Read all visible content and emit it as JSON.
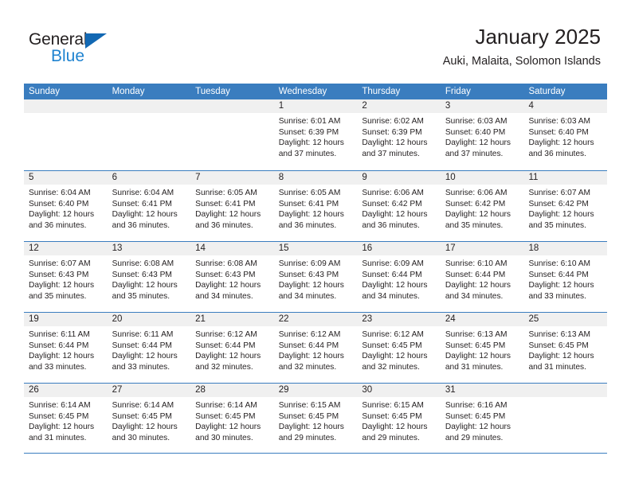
{
  "brand": {
    "name_part1": "General",
    "name_part2": "Blue",
    "accent_color": "#1f83d0",
    "triangle_color": "#1268b3"
  },
  "header": {
    "title": "January 2025",
    "subtitle": "Auki, Malaita, Solomon Islands"
  },
  "calendar": {
    "header_bg": "#3a7dbf",
    "daynum_bg": "#f0f0f0",
    "weekdays": [
      "Sunday",
      "Monday",
      "Tuesday",
      "Wednesday",
      "Thursday",
      "Friday",
      "Saturday"
    ],
    "weeks": [
      [
        {
          "day": "",
          "lines": []
        },
        {
          "day": "",
          "lines": []
        },
        {
          "day": "",
          "lines": []
        },
        {
          "day": "1",
          "lines": [
            "Sunrise: 6:01 AM",
            "Sunset: 6:39 PM",
            "Daylight: 12 hours",
            "and 37 minutes."
          ]
        },
        {
          "day": "2",
          "lines": [
            "Sunrise: 6:02 AM",
            "Sunset: 6:39 PM",
            "Daylight: 12 hours",
            "and 37 minutes."
          ]
        },
        {
          "day": "3",
          "lines": [
            "Sunrise: 6:03 AM",
            "Sunset: 6:40 PM",
            "Daylight: 12 hours",
            "and 37 minutes."
          ]
        },
        {
          "day": "4",
          "lines": [
            "Sunrise: 6:03 AM",
            "Sunset: 6:40 PM",
            "Daylight: 12 hours",
            "and 36 minutes."
          ]
        }
      ],
      [
        {
          "day": "5",
          "lines": [
            "Sunrise: 6:04 AM",
            "Sunset: 6:40 PM",
            "Daylight: 12 hours",
            "and 36 minutes."
          ]
        },
        {
          "day": "6",
          "lines": [
            "Sunrise: 6:04 AM",
            "Sunset: 6:41 PM",
            "Daylight: 12 hours",
            "and 36 minutes."
          ]
        },
        {
          "day": "7",
          "lines": [
            "Sunrise: 6:05 AM",
            "Sunset: 6:41 PM",
            "Daylight: 12 hours",
            "and 36 minutes."
          ]
        },
        {
          "day": "8",
          "lines": [
            "Sunrise: 6:05 AM",
            "Sunset: 6:41 PM",
            "Daylight: 12 hours",
            "and 36 minutes."
          ]
        },
        {
          "day": "9",
          "lines": [
            "Sunrise: 6:06 AM",
            "Sunset: 6:42 PM",
            "Daylight: 12 hours",
            "and 36 minutes."
          ]
        },
        {
          "day": "10",
          "lines": [
            "Sunrise: 6:06 AM",
            "Sunset: 6:42 PM",
            "Daylight: 12 hours",
            "and 35 minutes."
          ]
        },
        {
          "day": "11",
          "lines": [
            "Sunrise: 6:07 AM",
            "Sunset: 6:42 PM",
            "Daylight: 12 hours",
            "and 35 minutes."
          ]
        }
      ],
      [
        {
          "day": "12",
          "lines": [
            "Sunrise: 6:07 AM",
            "Sunset: 6:43 PM",
            "Daylight: 12 hours",
            "and 35 minutes."
          ]
        },
        {
          "day": "13",
          "lines": [
            "Sunrise: 6:08 AM",
            "Sunset: 6:43 PM",
            "Daylight: 12 hours",
            "and 35 minutes."
          ]
        },
        {
          "day": "14",
          "lines": [
            "Sunrise: 6:08 AM",
            "Sunset: 6:43 PM",
            "Daylight: 12 hours",
            "and 34 minutes."
          ]
        },
        {
          "day": "15",
          "lines": [
            "Sunrise: 6:09 AM",
            "Sunset: 6:43 PM",
            "Daylight: 12 hours",
            "and 34 minutes."
          ]
        },
        {
          "day": "16",
          "lines": [
            "Sunrise: 6:09 AM",
            "Sunset: 6:44 PM",
            "Daylight: 12 hours",
            "and 34 minutes."
          ]
        },
        {
          "day": "17",
          "lines": [
            "Sunrise: 6:10 AM",
            "Sunset: 6:44 PM",
            "Daylight: 12 hours",
            "and 34 minutes."
          ]
        },
        {
          "day": "18",
          "lines": [
            "Sunrise: 6:10 AM",
            "Sunset: 6:44 PM",
            "Daylight: 12 hours",
            "and 33 minutes."
          ]
        }
      ],
      [
        {
          "day": "19",
          "lines": [
            "Sunrise: 6:11 AM",
            "Sunset: 6:44 PM",
            "Daylight: 12 hours",
            "and 33 minutes."
          ]
        },
        {
          "day": "20",
          "lines": [
            "Sunrise: 6:11 AM",
            "Sunset: 6:44 PM",
            "Daylight: 12 hours",
            "and 33 minutes."
          ]
        },
        {
          "day": "21",
          "lines": [
            "Sunrise: 6:12 AM",
            "Sunset: 6:44 PM",
            "Daylight: 12 hours",
            "and 32 minutes."
          ]
        },
        {
          "day": "22",
          "lines": [
            "Sunrise: 6:12 AM",
            "Sunset: 6:44 PM",
            "Daylight: 12 hours",
            "and 32 minutes."
          ]
        },
        {
          "day": "23",
          "lines": [
            "Sunrise: 6:12 AM",
            "Sunset: 6:45 PM",
            "Daylight: 12 hours",
            "and 32 minutes."
          ]
        },
        {
          "day": "24",
          "lines": [
            "Sunrise: 6:13 AM",
            "Sunset: 6:45 PM",
            "Daylight: 12 hours",
            "and 31 minutes."
          ]
        },
        {
          "day": "25",
          "lines": [
            "Sunrise: 6:13 AM",
            "Sunset: 6:45 PM",
            "Daylight: 12 hours",
            "and 31 minutes."
          ]
        }
      ],
      [
        {
          "day": "26",
          "lines": [
            "Sunrise: 6:14 AM",
            "Sunset: 6:45 PM",
            "Daylight: 12 hours",
            "and 31 minutes."
          ]
        },
        {
          "day": "27",
          "lines": [
            "Sunrise: 6:14 AM",
            "Sunset: 6:45 PM",
            "Daylight: 12 hours",
            "and 30 minutes."
          ]
        },
        {
          "day": "28",
          "lines": [
            "Sunrise: 6:14 AM",
            "Sunset: 6:45 PM",
            "Daylight: 12 hours",
            "and 30 minutes."
          ]
        },
        {
          "day": "29",
          "lines": [
            "Sunrise: 6:15 AM",
            "Sunset: 6:45 PM",
            "Daylight: 12 hours",
            "and 29 minutes."
          ]
        },
        {
          "day": "30",
          "lines": [
            "Sunrise: 6:15 AM",
            "Sunset: 6:45 PM",
            "Daylight: 12 hours",
            "and 29 minutes."
          ]
        },
        {
          "day": "31",
          "lines": [
            "Sunrise: 6:16 AM",
            "Sunset: 6:45 PM",
            "Daylight: 12 hours",
            "and 29 minutes."
          ]
        },
        {
          "day": "",
          "lines": []
        }
      ]
    ]
  }
}
